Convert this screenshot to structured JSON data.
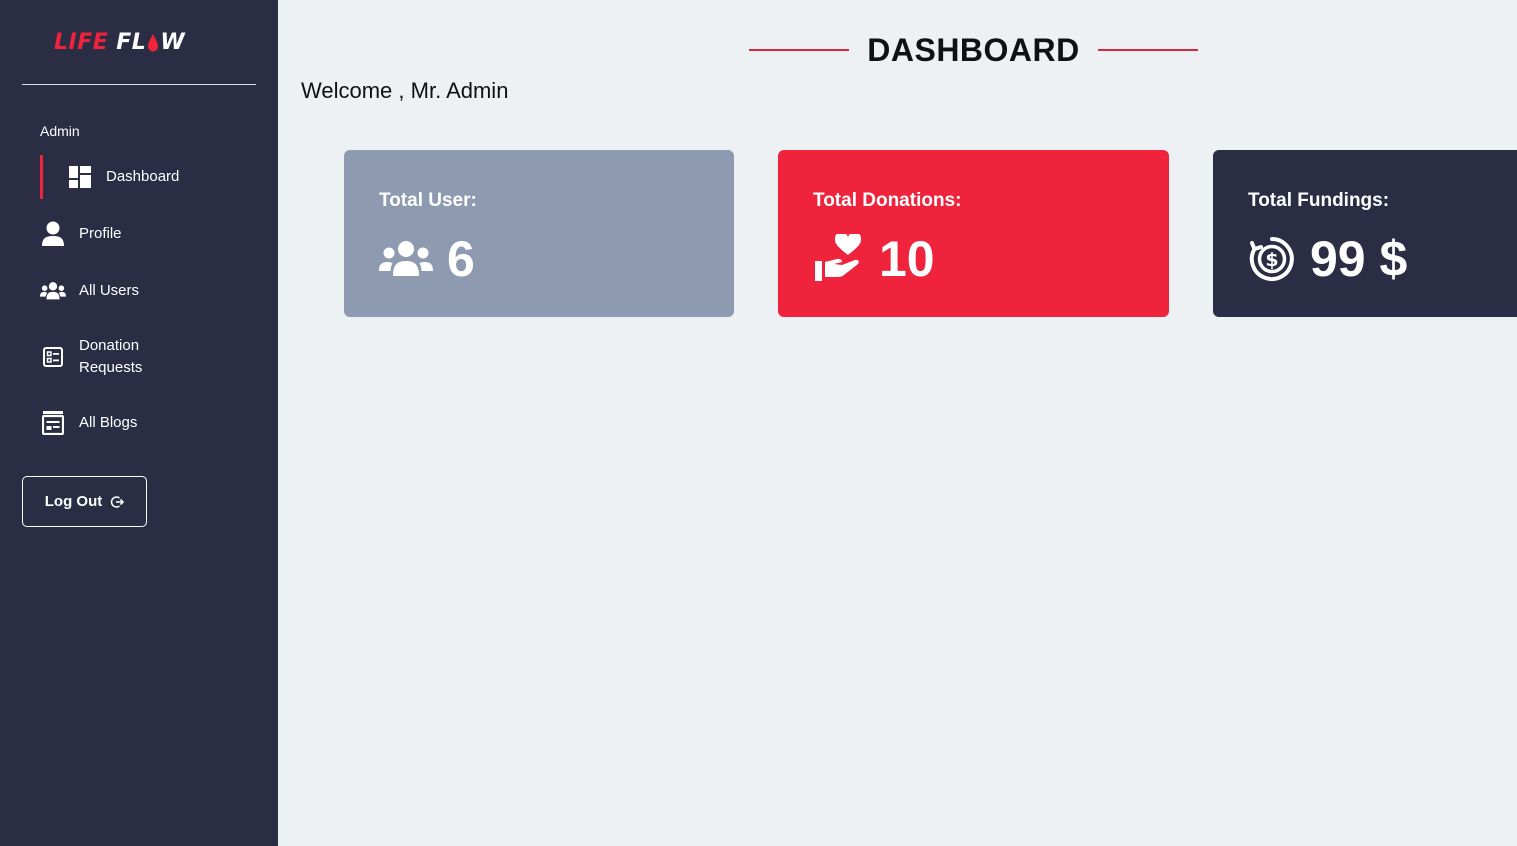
{
  "brand": {
    "part1": "LIFE",
    "part2": "FL",
    "part3": "W"
  },
  "sidebar": {
    "role": "Admin",
    "items": [
      {
        "label": "Dashboard",
        "icon": "dashboard-icon",
        "active": true
      },
      {
        "label": "Profile",
        "icon": "user-icon"
      },
      {
        "label": "All Users",
        "icon": "users-icon"
      },
      {
        "label": "Donation Requests",
        "icon": "list-icon"
      },
      {
        "label": "All Blogs",
        "icon": "blog-icon"
      }
    ],
    "logout_label": "Log Out"
  },
  "header": {
    "title": "DASHBOARD",
    "welcome": "Welcome , Mr. Admin"
  },
  "stats": [
    {
      "label": "Total User:",
      "value": "6",
      "icon": "users-icon",
      "color": "#8d9ab0"
    },
    {
      "label": "Total Donations:",
      "value": "10",
      "icon": "hand-heart-icon",
      "color": "#ef233c"
    },
    {
      "label": "Total Fundings:",
      "value": "99 $",
      "icon": "dollar-circle-icon",
      "color": "#2a2d43"
    }
  ],
  "colors": {
    "accent": "#ef233c",
    "sidebar": "#2a2d43",
    "background": "#edf1f4"
  }
}
